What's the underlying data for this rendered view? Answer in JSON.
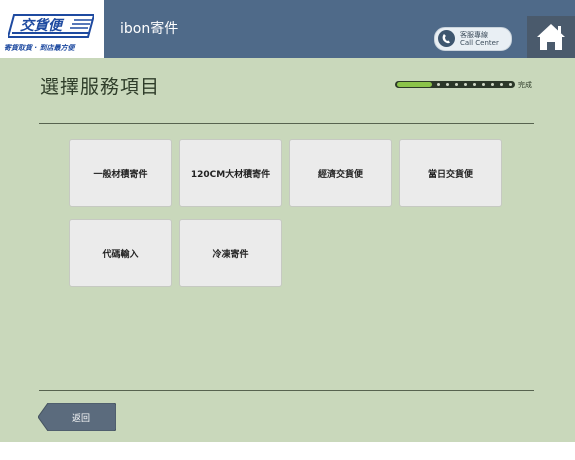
{
  "header": {
    "logo_text": "交貨便",
    "logo_tagline": "寄貨取貨 · 到店最方便",
    "app_title": "ibon寄件",
    "call_center_line1": "客服專線",
    "call_center_line2": "Call Center",
    "home_icon": "home-icon",
    "phone_icon": "phone-icon"
  },
  "main": {
    "page_title": "選擇服務項目",
    "progress": {
      "end_label": "完成",
      "fraction_complete": 0.3
    },
    "tiles": [
      {
        "label": "一般材積寄件"
      },
      {
        "label": "120CM大材積寄件"
      },
      {
        "label": "經濟交貨便"
      },
      {
        "label": "當日交貨便"
      },
      {
        "label": "代碼輸入"
      },
      {
        "label": "冷凍寄件"
      }
    ],
    "back_label": "返回"
  },
  "colors": {
    "header_bg": "#4f6a89",
    "main_bg": "#c9d8bb",
    "tile_bg": "#ebebeb",
    "progress_fill": "#8bc34a",
    "back_button": "#5b6b7d",
    "logo_blue": "#1e4aa0"
  }
}
